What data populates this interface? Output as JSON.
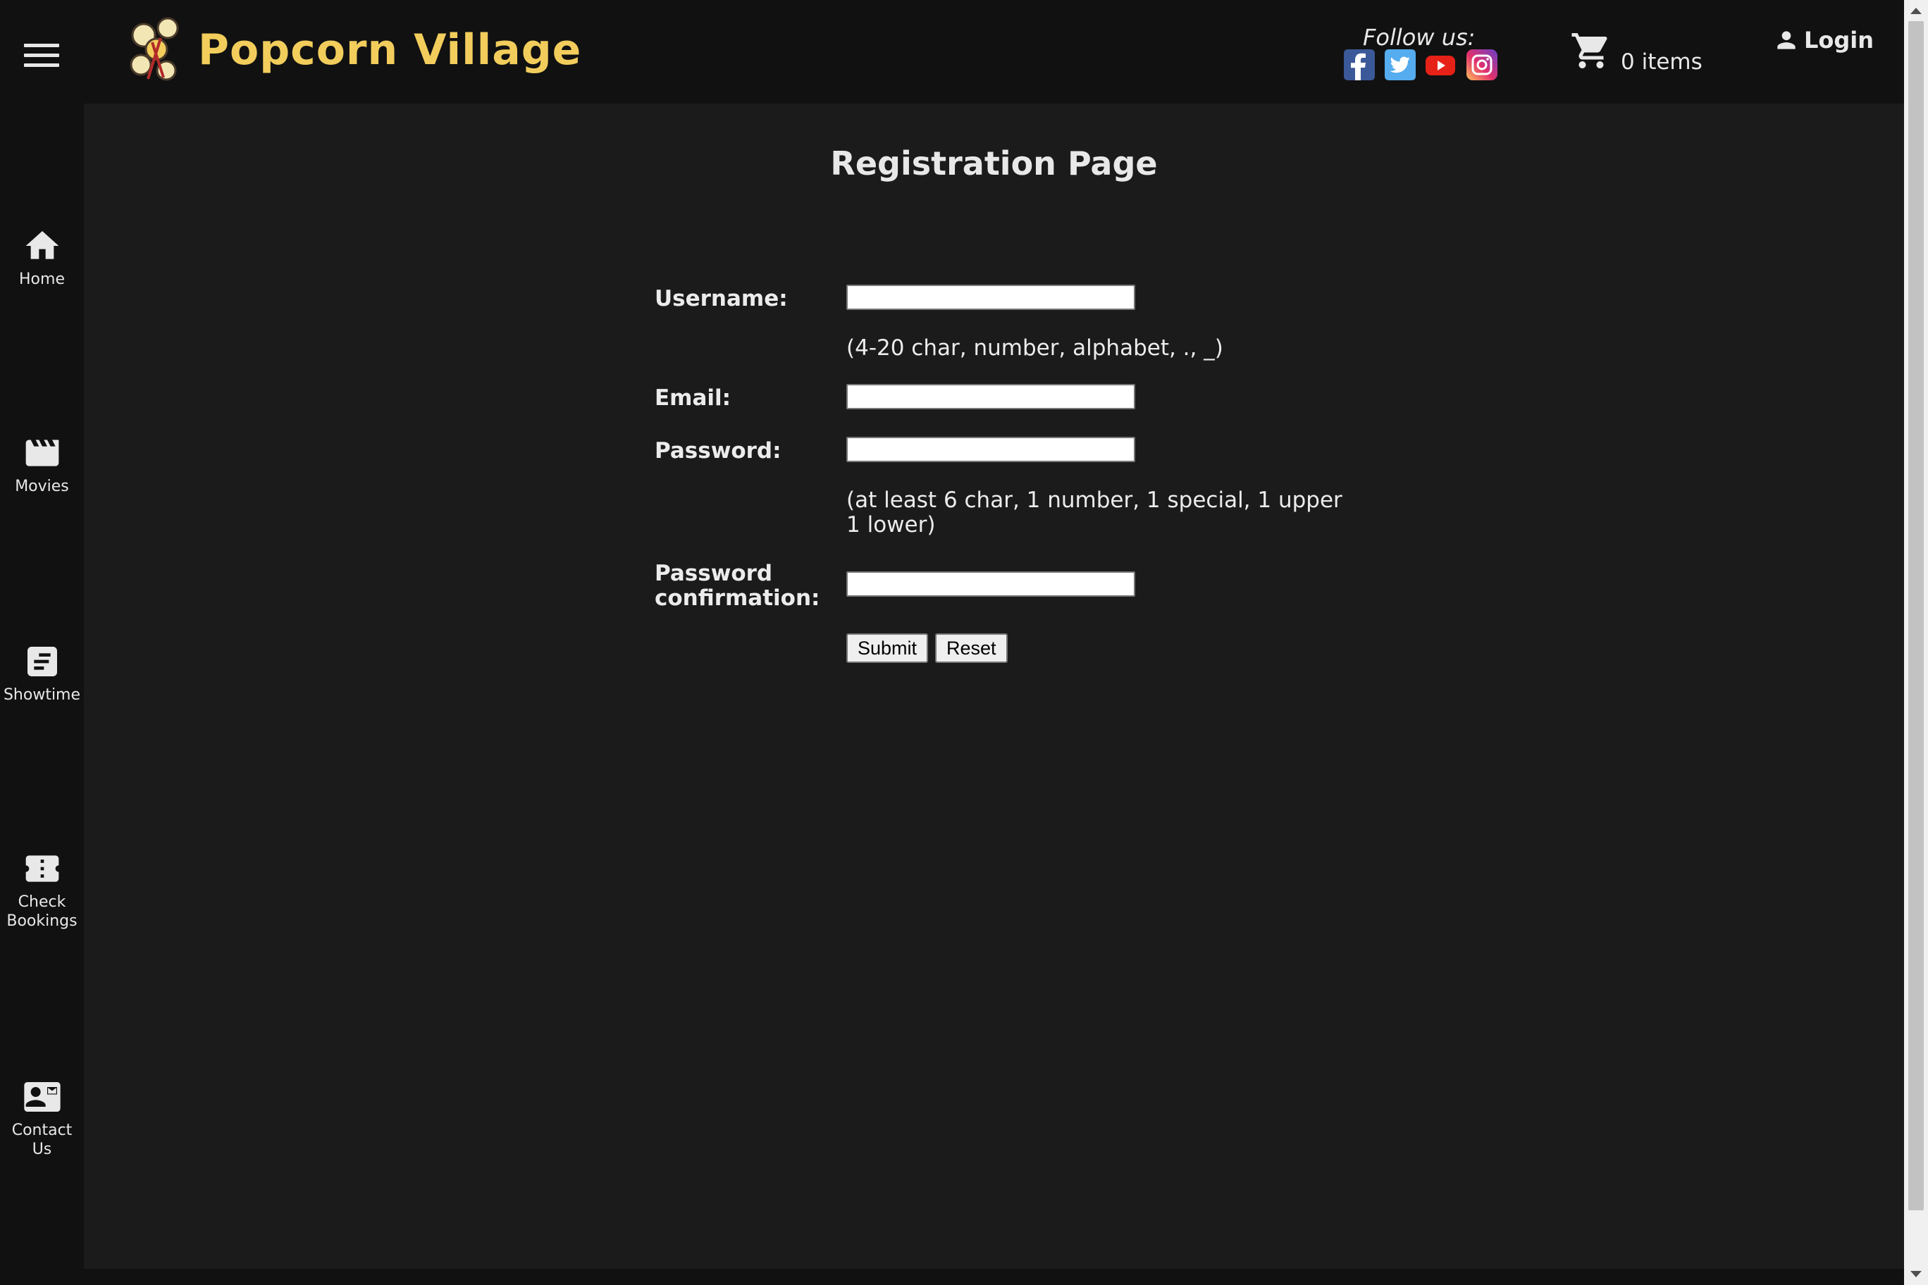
{
  "header": {
    "brand": "Popcorn Village",
    "follow_label": "Follow us:",
    "social_icons": [
      "facebook-icon",
      "twitter-icon",
      "youtube-icon",
      "instagram-icon"
    ],
    "cart_label": "0 items",
    "login_label": "Login"
  },
  "sidebar": {
    "items": [
      {
        "label": "Home",
        "icon": "home-icon"
      },
      {
        "label": "Movies",
        "icon": "clapperboard-icon"
      },
      {
        "label": "Showtime",
        "icon": "showtime-icon"
      },
      {
        "label": "Check\nBookings",
        "icon": "ticket-icon"
      },
      {
        "label": "Contact\nUs",
        "icon": "contact-card-icon"
      }
    ]
  },
  "main": {
    "title": "Registration Page",
    "form": {
      "username_label": "Username:",
      "username_value": "",
      "username_hint": "(4-20 char, number, alphabet, ., _)",
      "email_label": "Email:",
      "email_value": "",
      "password_label": "Password:",
      "password_value": "",
      "password_hint": "(at least 6 char, 1 number, 1 special, 1 upper 1 lower)",
      "confirm_label": "Password confirmation:",
      "confirm_value": "",
      "submit_label": "Submit",
      "reset_label": "Reset"
    }
  },
  "colors": {
    "brand_yellow": "#f2cd5c",
    "header_bg": "#111111",
    "main_bg": "#1b1b1b"
  }
}
